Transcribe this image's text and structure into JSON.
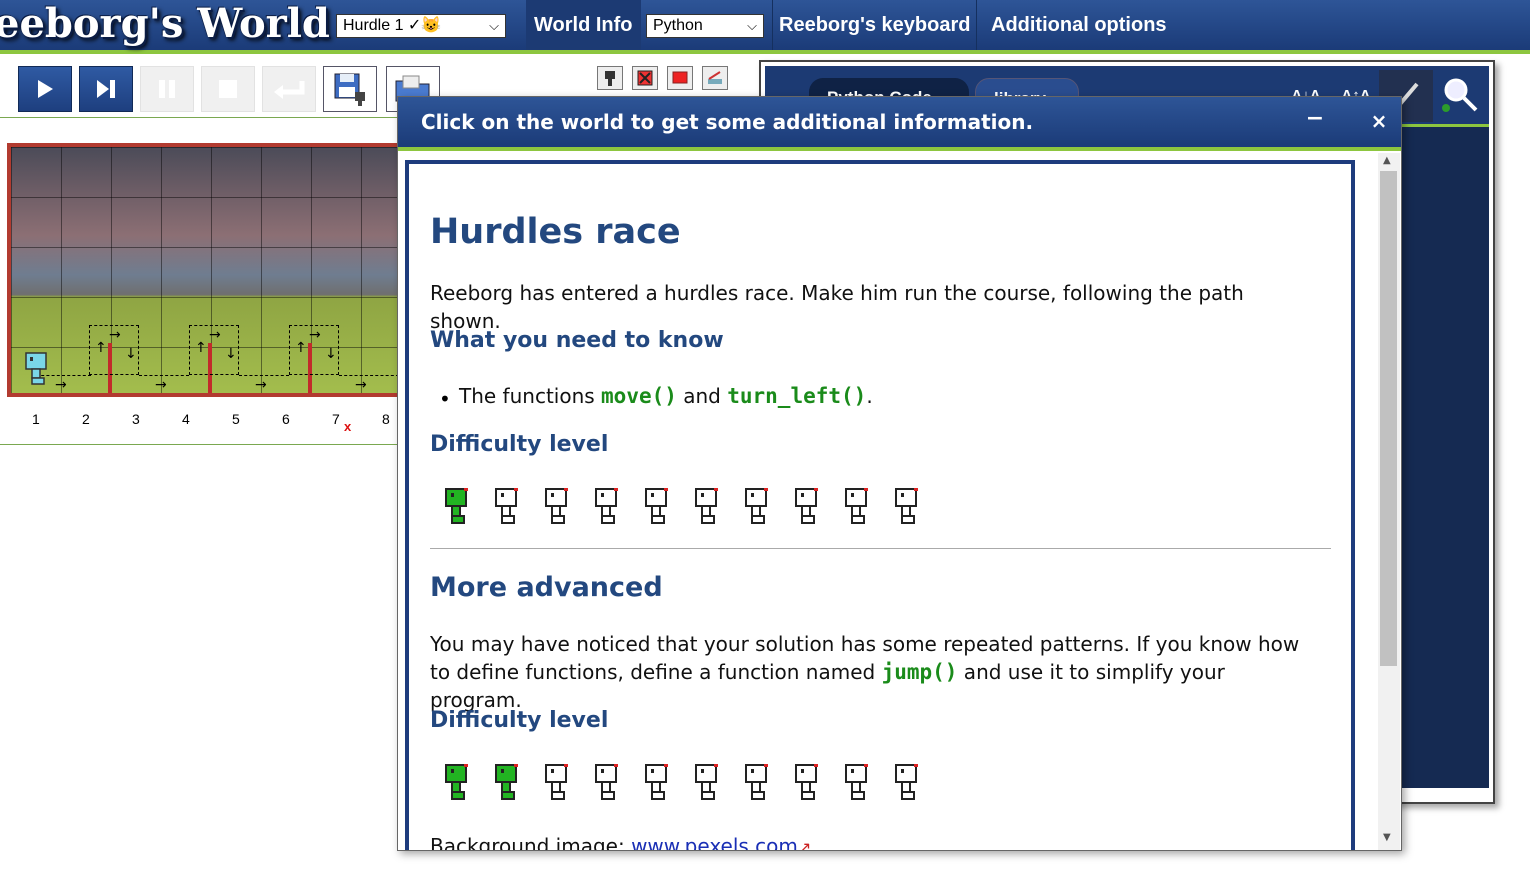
{
  "header": {
    "app_title": "eeborg's World",
    "world_select_value": "Hurdle 1 ✓😺",
    "world_info_label": "World Info",
    "language_select_value": "Python",
    "keyboard_label": "Reeborg's keyboard",
    "options_label": "Additional options"
  },
  "colors": {
    "header_blue": "#1c3a73",
    "accent_green": "#8dc63f",
    "heading_blue": "#23487f",
    "code_green": "#1a8b1a",
    "hurdle_red": "#c22b2b"
  },
  "toolbar": {
    "buttons": [
      "play-icon",
      "step-icon",
      "pause-icon",
      "stop-icon",
      "reverse-step-icon",
      "save-icon",
      "open-icon"
    ],
    "edit_tools": [
      "robot-tool-icon",
      "wall-tool-icon",
      "flag-tool-icon",
      "pencil-tool-icon"
    ]
  },
  "world": {
    "x_axis": [
      "1",
      "2",
      "3",
      "4",
      "5",
      "6",
      "7",
      "8"
    ],
    "goal_marker": "x"
  },
  "editor": {
    "tab_python": "Python Code",
    "tab_library": "library",
    "font_decrease": "A↓A",
    "font_increase": "A↑A"
  },
  "dialog": {
    "title": "Click on the world to get some additional information.",
    "minimize": "−",
    "close": "×",
    "heading": "Hurdles race",
    "intro": "Reeborg has entered a hurdles race. Make him run the course, following the path shown.",
    "need_heading": "What you need to know",
    "bullet_prefix": "The functions ",
    "bullet_code1": "move()",
    "bullet_and": " and ",
    "bullet_code2": "turn_left()",
    "bullet_suffix": ".",
    "difficulty_heading": "Difficulty level",
    "difficulty_1": {
      "filled": 1,
      "total": 10
    },
    "advanced_heading": "More advanced",
    "advanced_text_a": "You may have noticed that your solution has some repeated patterns. If you know how to define functions, define a function named ",
    "advanced_code": "jump()",
    "advanced_text_b": " and use it to simplify your program.",
    "difficulty_heading_2": "Difficulty level",
    "difficulty_2": {
      "filled": 2,
      "total": 10
    },
    "credit_label": "Background image: ",
    "credit_link": "www.pexels.com"
  }
}
